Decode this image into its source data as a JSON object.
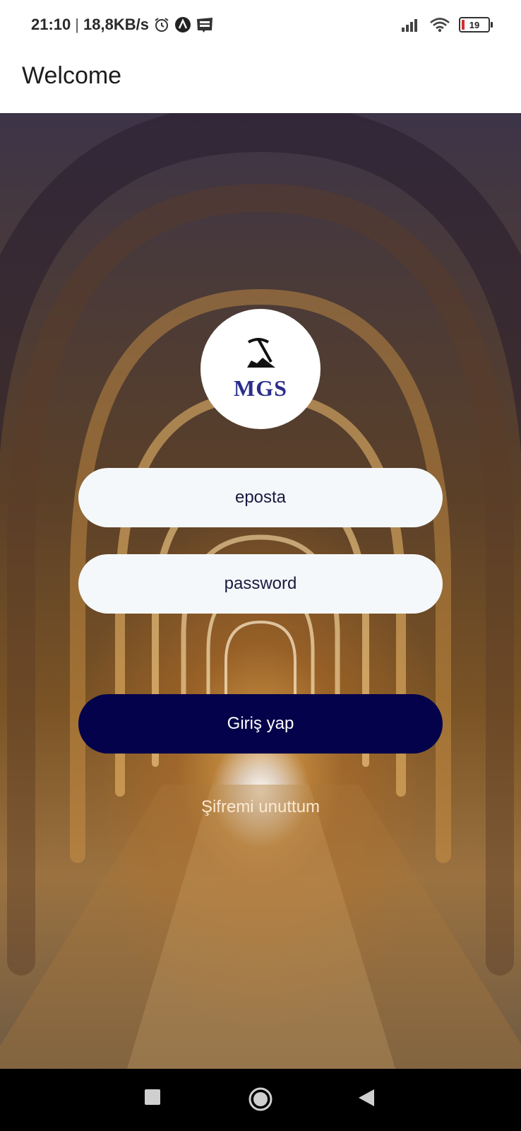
{
  "status_bar": {
    "time": "21:10",
    "separator": "|",
    "speed": "18,8KB/s",
    "battery_level": "19",
    "icons": [
      "alarm-icon",
      "app-notification-icon",
      "webtoon-icon",
      "signal-icon",
      "wifi-icon",
      "battery-icon"
    ]
  },
  "app_bar": {
    "title": "Welcome"
  },
  "logo": {
    "text": "MGS",
    "icon": "pickaxe-icon"
  },
  "form": {
    "email_placeholder": "eposta",
    "password_placeholder": "password",
    "login_label": "Giriş yap",
    "forgot_label": "Şifremi unuttum"
  },
  "nav_bar": {
    "icons": [
      "recents-icon",
      "home-icon",
      "back-icon"
    ]
  },
  "colors": {
    "button": "#03024a",
    "field_bg": "#f5f8fa",
    "logo_text": "#2a2d8c"
  }
}
